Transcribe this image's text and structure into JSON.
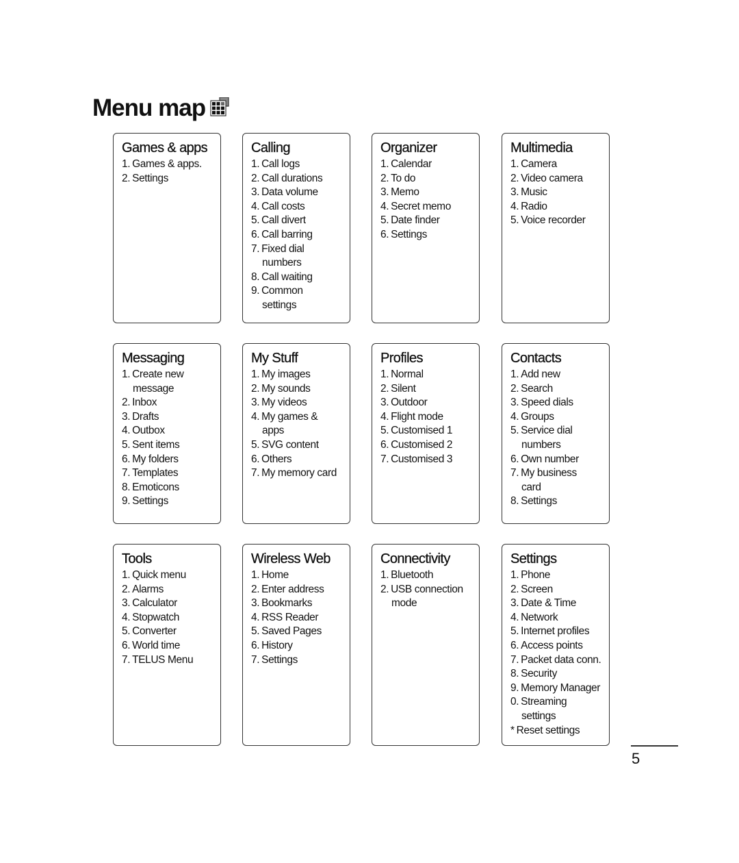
{
  "title": "Menu map",
  "page_number": "5",
  "menus": [
    {
      "title": "Games & apps",
      "items": [
        {
          "n": "1.",
          "t": "Games & apps."
        },
        {
          "n": "2.",
          "t": "Settings"
        }
      ]
    },
    {
      "title": "Calling",
      "items": [
        {
          "n": "1.",
          "t": "Call logs"
        },
        {
          "n": "2.",
          "t": "Call durations"
        },
        {
          "n": "3.",
          "t": "Data volume"
        },
        {
          "n": "4.",
          "t": "Call costs"
        },
        {
          "n": "5.",
          "t": "Call divert"
        },
        {
          "n": "6.",
          "t": "Call barring"
        },
        {
          "n": "7.",
          "t": "Fixed dial",
          "c": "numbers"
        },
        {
          "n": "8.",
          "t": "Call waiting"
        },
        {
          "n": "9.",
          "t": "Common",
          "c": "settings"
        }
      ]
    },
    {
      "title": "Organizer",
      "items": [
        {
          "n": "1.",
          "t": "Calendar"
        },
        {
          "n": "2.",
          "t": "To do"
        },
        {
          "n": "3.",
          "t": "Memo"
        },
        {
          "n": "4.",
          "t": "Secret memo"
        },
        {
          "n": "5.",
          "t": "Date finder"
        },
        {
          "n": "6.",
          "t": "Settings"
        }
      ]
    },
    {
      "title": "Multimedia",
      "items": [
        {
          "n": "1.",
          "t": "Camera"
        },
        {
          "n": "2.",
          "t": "Video camera"
        },
        {
          "n": "3.",
          "t": "Music"
        },
        {
          "n": "4.",
          "t": "Radio"
        },
        {
          "n": "5.",
          "t": "Voice recorder"
        }
      ]
    },
    {
      "title": "Messaging",
      "items": [
        {
          "n": "1.",
          "t": "Create new",
          "c": "message"
        },
        {
          "n": "2.",
          "t": "Inbox"
        },
        {
          "n": "3.",
          "t": "Drafts"
        },
        {
          "n": "4.",
          "t": "Outbox"
        },
        {
          "n": "5.",
          "t": "Sent items"
        },
        {
          "n": "6.",
          "t": "My folders"
        },
        {
          "n": "7.",
          "t": "Templates"
        },
        {
          "n": "8.",
          "t": "Emoticons"
        },
        {
          "n": "9.",
          "t": "Settings"
        }
      ]
    },
    {
      "title": "My Stuff",
      "items": [
        {
          "n": "1.",
          "t": "My images"
        },
        {
          "n": "2.",
          "t": "My sounds"
        },
        {
          "n": "3.",
          "t": "My videos"
        },
        {
          "n": "4.",
          "t": "My games &",
          "c": "apps"
        },
        {
          "n": "5.",
          "t": "SVG content"
        },
        {
          "n": "6.",
          "t": "Others"
        },
        {
          "n": "7.",
          "t": "My memory card"
        }
      ]
    },
    {
      "title": "Profiles",
      "items": [
        {
          "n": "1.",
          "t": "Normal"
        },
        {
          "n": "2.",
          "t": "Silent"
        },
        {
          "n": "3.",
          "t": "Outdoor"
        },
        {
          "n": "4.",
          "t": "Flight mode"
        },
        {
          "n": "5.",
          "t": "Customised 1"
        },
        {
          "n": "6.",
          "t": "Customised 2"
        },
        {
          "n": "7.",
          "t": "Customised 3"
        }
      ]
    },
    {
      "title": "Contacts",
      "items": [
        {
          "n": "1.",
          "t": "Add new"
        },
        {
          "n": "2.",
          "t": "Search"
        },
        {
          "n": "3.",
          "t": "Speed dials"
        },
        {
          "n": "4.",
          "t": "Groups"
        },
        {
          "n": "5.",
          "t": "Service dial",
          "c": "numbers"
        },
        {
          "n": "6.",
          "t": "Own number"
        },
        {
          "n": "7.",
          "t": "My business",
          "c": "card"
        },
        {
          "n": "8.",
          "t": "Settings"
        }
      ]
    },
    {
      "title": "Tools",
      "items": [
        {
          "n": "1.",
          "t": "Quick menu"
        },
        {
          "n": "2.",
          "t": "Alarms"
        },
        {
          "n": "3.",
          "t": "Calculator"
        },
        {
          "n": "4.",
          "t": "Stopwatch"
        },
        {
          "n": "5.",
          "t": "Converter"
        },
        {
          "n": "6.",
          "t": "World time"
        },
        {
          "n": "7.",
          "t": "TELUS Menu"
        }
      ]
    },
    {
      "title": "Wireless Web",
      "items": [
        {
          "n": "1.",
          "t": "Home"
        },
        {
          "n": "2.",
          "t": "Enter address"
        },
        {
          "n": "3.",
          "t": "Bookmarks"
        },
        {
          "n": "4.",
          "t": "RSS Reader"
        },
        {
          "n": "5.",
          "t": "Saved Pages"
        },
        {
          "n": "6.",
          "t": "History"
        },
        {
          "n": "7.",
          "t": "Settings"
        }
      ]
    },
    {
      "title": "Connectivity",
      "items": [
        {
          "n": "1.",
          "t": "Bluetooth"
        },
        {
          "n": "2.",
          "t": "USB connection",
          "c": "mode"
        }
      ]
    },
    {
      "title": "Settings",
      "items": [
        {
          "n": "1.",
          "t": "Phone"
        },
        {
          "n": "2.",
          "t": "Screen"
        },
        {
          "n": "3.",
          "t": "Date & Time"
        },
        {
          "n": "4.",
          "t": "Network"
        },
        {
          "n": "5.",
          "t": "Internet profiles"
        },
        {
          "n": "6.",
          "t": "Access points"
        },
        {
          "n": "7.",
          "t": "Packet data conn."
        },
        {
          "n": "8.",
          "t": "Security"
        },
        {
          "n": "9.",
          "t": "Memory Manager"
        },
        {
          "n": "0.",
          "t": "Streaming",
          "c": "settings"
        },
        {
          "n": "*",
          "t": "Reset settings"
        }
      ]
    }
  ]
}
